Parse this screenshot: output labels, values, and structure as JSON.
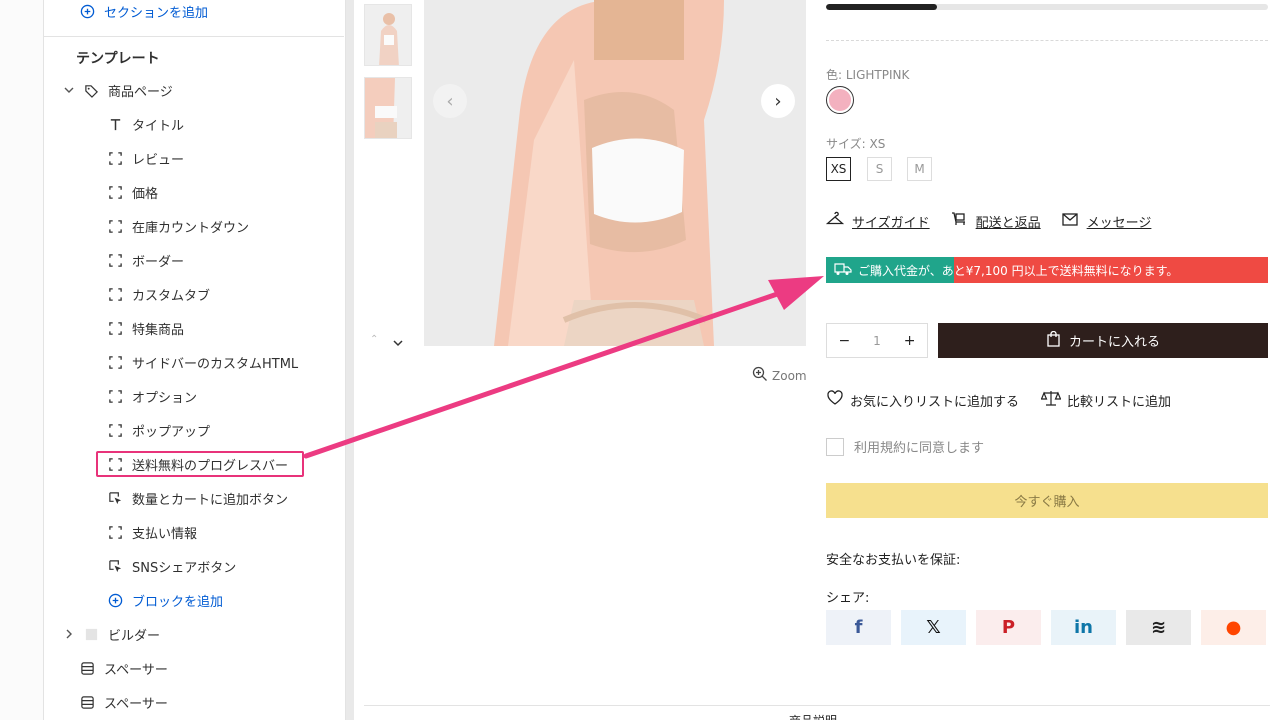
{
  "sidebar": {
    "add_section": "セクションを追加",
    "template_heading": "テンプレート",
    "product_page": "商品ページ",
    "blocks": [
      {
        "label": "タイトル",
        "icon": "title-icon"
      },
      {
        "label": "レビュー",
        "icon": "block-frame-icon"
      },
      {
        "label": "価格",
        "icon": "block-frame-icon"
      },
      {
        "label": "在庫カウントダウン",
        "icon": "block-frame-icon"
      },
      {
        "label": "ボーダー",
        "icon": "block-frame-icon"
      },
      {
        "label": "カスタムタブ",
        "icon": "block-frame-icon"
      },
      {
        "label": "特集商品",
        "icon": "block-frame-icon"
      },
      {
        "label": "サイドバーのカスタムHTML",
        "icon": "block-frame-icon"
      },
      {
        "label": "オプション",
        "icon": "block-frame-icon"
      },
      {
        "label": "ポップアップ",
        "icon": "block-frame-icon"
      },
      {
        "label": "送料無料のプログレスバー",
        "icon": "block-frame-icon"
      },
      {
        "label": "数量とカートに追加ボタン",
        "icon": "cursor-click-icon"
      },
      {
        "label": "支払い情報",
        "icon": "block-frame-icon"
      },
      {
        "label": "SNSシェアボタン",
        "icon": "cursor-click-icon"
      }
    ],
    "add_block": "ブロックを追加",
    "builder": "ビルダー",
    "spacer1": "スペーサー",
    "spacer2": "スペーサー"
  },
  "preview": {
    "zoom": "Zoom",
    "color_label": "色: LIGHTPINK",
    "size_label": "サイズ: XS",
    "sizes": [
      "XS",
      "S",
      "M"
    ],
    "selected_size": "XS",
    "size_guide": "サイズガイド",
    "shipping_returns": "配送と返品",
    "message": "メッセージ",
    "shipping_bar_text": "ご購入代金が、あと¥7,100 円以上で送料無料になります。",
    "shipping_progress_fraction": 0.29,
    "top_progress_fraction": 0.25,
    "qty_minus": "−",
    "qty_value": "1",
    "qty_plus": "+",
    "add_to_cart": "カートに入れる",
    "wishlist": "お気に入りリストに追加する",
    "compare": "比較リストに追加",
    "terms": "利用規約に同意します",
    "buy_now": "今すぐ購入",
    "safe_payment": "安全なお支払いを保証:",
    "share_label": "シェア:",
    "share_buttons": [
      {
        "name": "facebook",
        "glyph": "f",
        "color": "#3b5998",
        "bg": "#eef2f8"
      },
      {
        "name": "x",
        "glyph": "𝕏",
        "color": "#111111",
        "bg": "#e8f3fb"
      },
      {
        "name": "pinterest",
        "glyph": "P",
        "color": "#cb2027",
        "bg": "#fbeded"
      },
      {
        "name": "linkedin",
        "glyph": "in",
        "color": "#0e76a8",
        "bg": "#e9f3f9"
      },
      {
        "name": "buffer",
        "glyph": "≋",
        "color": "#222222",
        "bg": "#e9e9e9"
      },
      {
        "name": "reddit",
        "glyph": "●",
        "color": "#ff4500",
        "bg": "#fdeee8"
      }
    ],
    "bottom_tab": "商品説明"
  },
  "colors": {
    "accent_blue": "#005bd3",
    "highlight_pink": "#e8337a",
    "ship_green": "#20a58b",
    "ship_red": "#ef4a43",
    "cart_dark": "#2e1f1c",
    "buy_yellow": "#f6e08e",
    "swatch_pink": "#f3b1bf"
  }
}
